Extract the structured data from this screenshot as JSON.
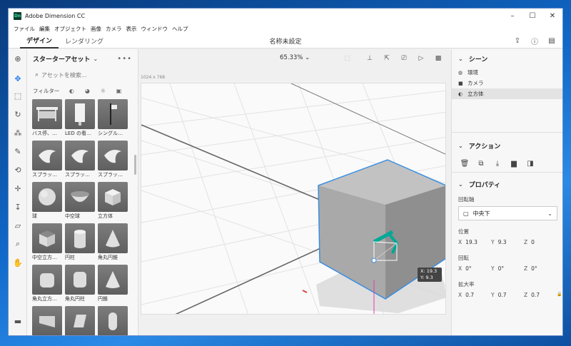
{
  "window": {
    "title": "Adobe Dimension CC",
    "logo": "Dn"
  },
  "menu": [
    "ファイル",
    "編集",
    "オブジェクト",
    "画像",
    "カメラ",
    "表示",
    "ウィンドウ",
    "ヘルプ"
  ],
  "mode_tabs": [
    "デザイン",
    "レンダリング"
  ],
  "document_title": "名称未設定",
  "assets_panel": {
    "title": "スターターアセット",
    "search_placeholder": "アセットを検索...",
    "filter_label": "フィルター",
    "items": [
      {
        "label": "バス停、…",
        "thumb": "bus-stop"
      },
      {
        "label": "LED の看…",
        "thumb": "led-sign"
      },
      {
        "label": "シングル…",
        "thumb": "single-sign"
      },
      {
        "label": "スプラッ…",
        "thumb": "splash"
      },
      {
        "label": "スプラッ…",
        "thumb": "splash"
      },
      {
        "label": "スプラッ…",
        "thumb": "splash"
      },
      {
        "label": "球",
        "thumb": "sphere"
      },
      {
        "label": "中空球",
        "thumb": "hollow-sphere"
      },
      {
        "label": "立方体",
        "thumb": "cube"
      },
      {
        "label": "中空立方…",
        "thumb": "hollow-cube"
      },
      {
        "label": "円柱",
        "thumb": "cylinder"
      },
      {
        "label": "角丸円錐",
        "thumb": "rounded-cone"
      },
      {
        "label": "角丸立方…",
        "thumb": "rounded-cube"
      },
      {
        "label": "角丸円柱",
        "thumb": "rounded-cylinder"
      },
      {
        "label": "円錐",
        "thumb": "cone"
      },
      {
        "label": "",
        "thumb": "wedge"
      },
      {
        "label": "",
        "thumb": "prism"
      },
      {
        "label": "",
        "thumb": "capsule"
      }
    ]
  },
  "viewport": {
    "zoom": "65.33%",
    "canvas_size": "1024 x 768",
    "readout_x": "X: 19.3",
    "readout_y": "Y: 9.3"
  },
  "scene_panel": {
    "title": "シーン",
    "items": [
      {
        "label": "環境",
        "icon": "globe-icon"
      },
      {
        "label": "カメラ",
        "icon": "camera-icon"
      },
      {
        "label": "立方体",
        "icon": "object-icon",
        "selected": true
      }
    ]
  },
  "actions_panel": {
    "title": "アクション"
  },
  "properties_panel": {
    "title": "プロパティ",
    "pivot_label": "回転軸",
    "pivot_value": "中央下",
    "position_label": "位置",
    "position": {
      "x": "19.3",
      "y": "9.3",
      "z": "0"
    },
    "rotation_label": "回転",
    "rotation": {
      "x": "0°",
      "y": "0°",
      "z": "0°"
    },
    "scale_label": "拡大率",
    "scale": {
      "x": "0.7",
      "y": "0.7",
      "z": "0.7"
    }
  },
  "axis_labels": {
    "x": "X",
    "y": "Y",
    "z": "Z"
  },
  "colors": {
    "accent": "#2680eb",
    "selection": "#3a8ee0",
    "gizmo": "#00a896"
  }
}
